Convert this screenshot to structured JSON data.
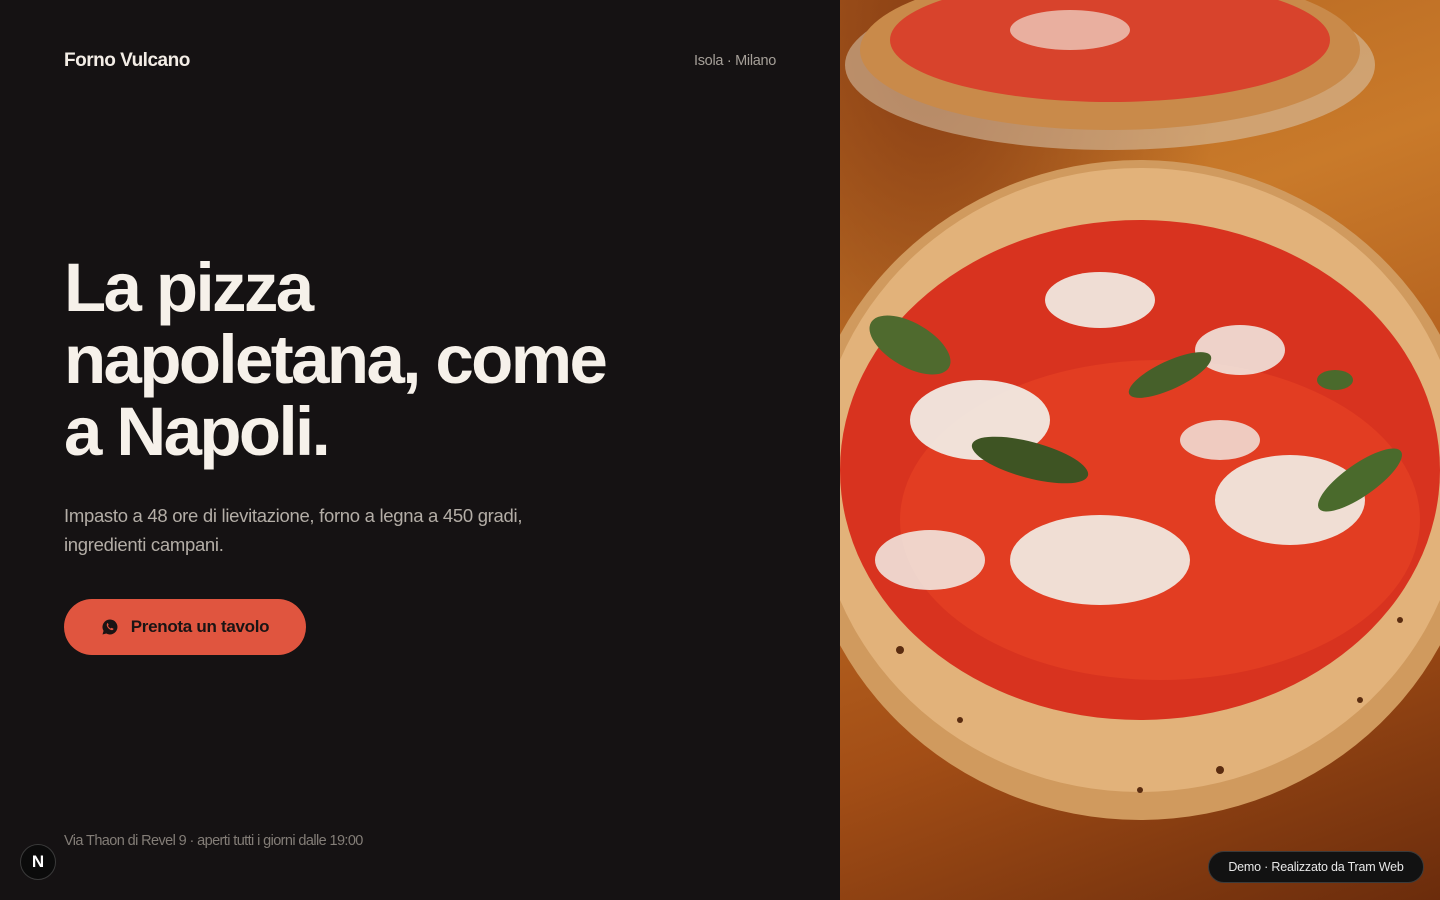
{
  "header": {
    "brand": "Forno Vulcano",
    "location": "Isola · Milano"
  },
  "hero": {
    "headline_lines": [
      "La pizza",
      "napoletana, come",
      "a Napoli."
    ],
    "subtitle": "Impasto a 48 ore di lievitazione, forno a legna a 450 gradi, ingredienti campani.",
    "cta_label": "Prenota un tavolo",
    "cta_icon": "whatsapp-icon"
  },
  "footer": {
    "address": "Via Thaon di Revel 9 · aperti tutti i giorni dalle 19:00",
    "n_badge": "N"
  },
  "demo_badge": "Demo · Realizzato da Tram Web",
  "colors": {
    "background": "#151213",
    "accent": "#e0553f",
    "headline": "#f6f1ea",
    "muted_text": "#b3ada6"
  }
}
